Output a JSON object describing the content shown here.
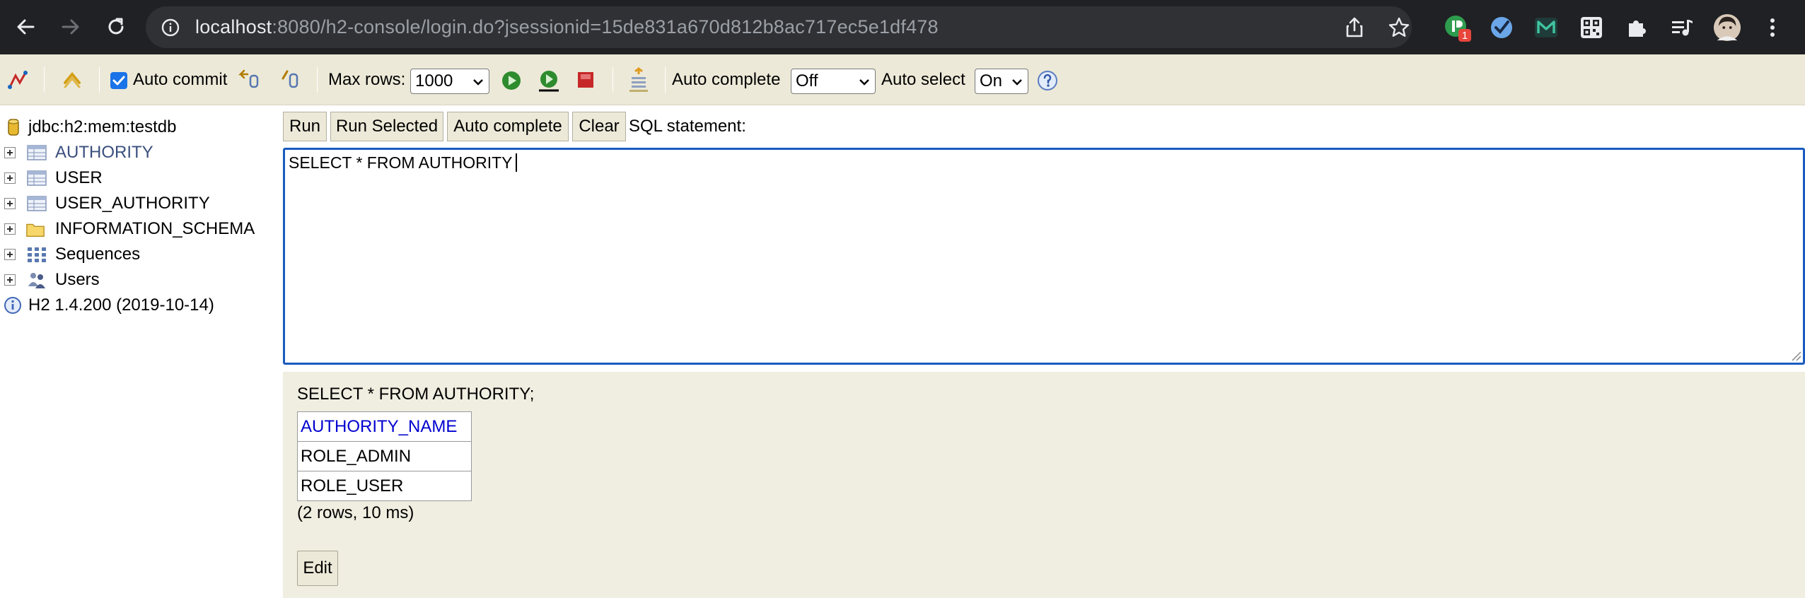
{
  "browser": {
    "url_host": "localhost",
    "url_path": ":8080/h2-console/login.do?jsessionid=15de831a670d812b8ac717ec5e1df478",
    "extension_badge": "1",
    "accent_badge_color": "#e8453c"
  },
  "toolbar": {
    "auto_commit_label": "Auto commit",
    "auto_commit_checked": true,
    "max_rows_label": "Max rows:",
    "max_rows_value": "1000",
    "auto_complete_label": "Auto complete",
    "auto_complete_value": "Off",
    "auto_select_label": "Auto select",
    "auto_select_value": "On"
  },
  "tree": {
    "connection": "jdbc:h2:mem:testdb",
    "items": [
      {
        "label": "AUTHORITY",
        "icon": "table-icon"
      },
      {
        "label": "USER",
        "icon": "table-icon"
      },
      {
        "label": "USER_AUTHORITY",
        "icon": "table-icon"
      },
      {
        "label": "INFORMATION_SCHEMA",
        "icon": "folder-icon"
      },
      {
        "label": "Sequences",
        "icon": "sequences-icon"
      },
      {
        "label": "Users",
        "icon": "users-icon"
      }
    ],
    "version": "H2 1.4.200 (2019-10-14)"
  },
  "query": {
    "run_label": "Run",
    "run_selected_label": "Run Selected",
    "auto_complete_label": "Auto complete",
    "clear_label": "Clear",
    "sql_statement_label": "SQL statement:",
    "sql_text": "SELECT * FROM AUTHORITY"
  },
  "results": {
    "sql": "SELECT * FROM AUTHORITY;",
    "column": "AUTHORITY_NAME",
    "rows": [
      "ROLE_ADMIN",
      "ROLE_USER"
    ],
    "summary": "(2 rows, 10 ms)",
    "edit_label": "Edit"
  }
}
